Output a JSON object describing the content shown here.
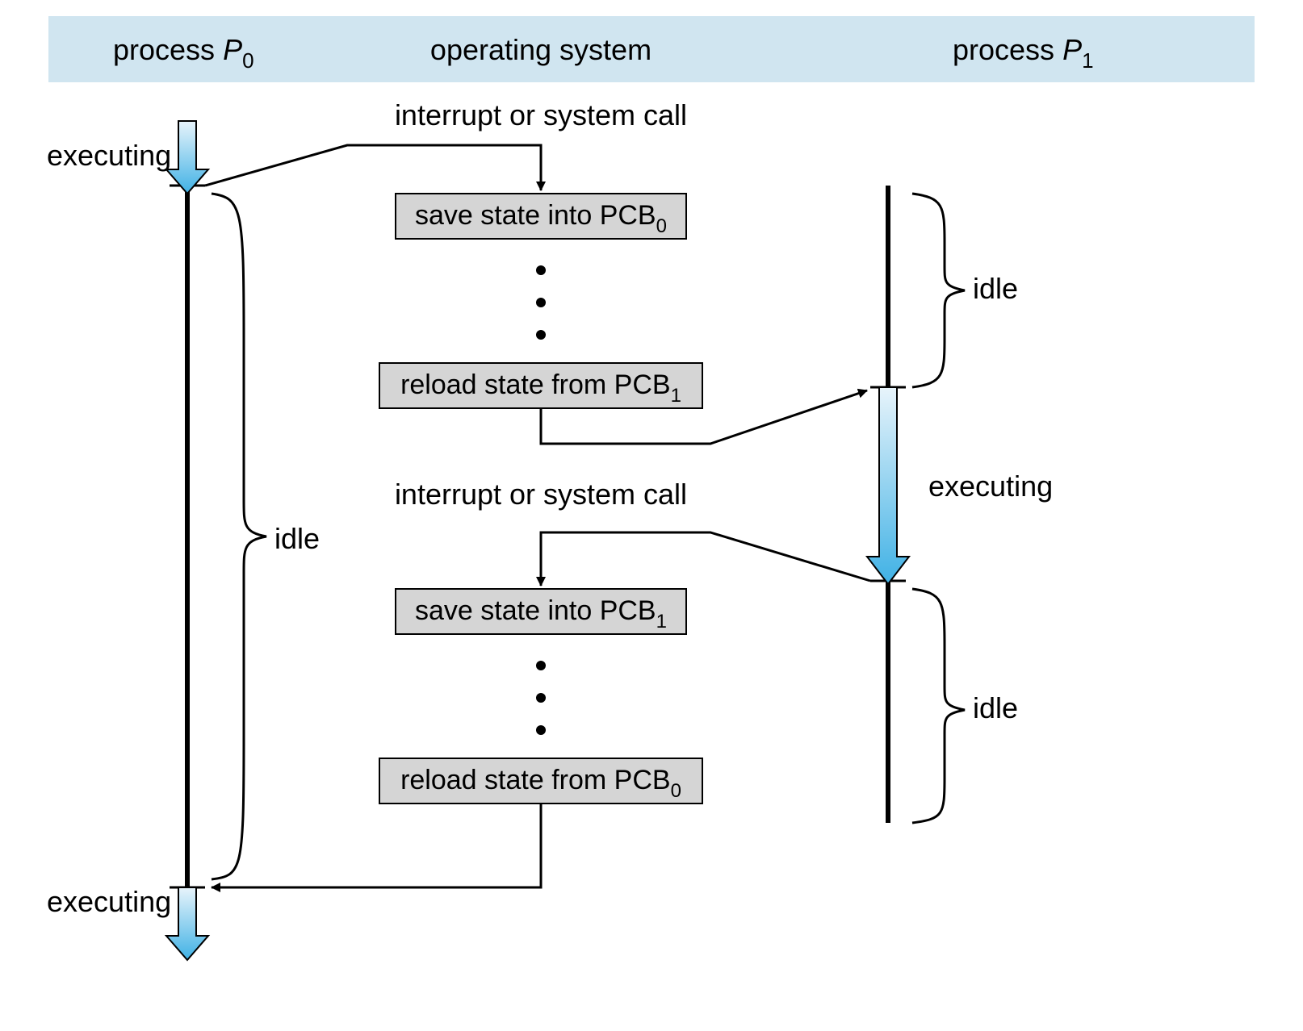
{
  "header": {
    "left": {
      "text": "process ",
      "ital": "P",
      "sub": "0"
    },
    "center": "operating system",
    "right": {
      "text": "process ",
      "ital": "P",
      "sub": "1"
    }
  },
  "labels": {
    "executing_top": "executing",
    "executing_bottom": "executing",
    "executing_right": "executing",
    "idle_left": "idle",
    "idle_right_top": "idle",
    "idle_right_bottom": "idle",
    "interrupt1": "interrupt or system call",
    "interrupt2": "interrupt or system call"
  },
  "boxes": {
    "save0": {
      "text": "save state into PCB",
      "sub": "0"
    },
    "reload1": {
      "text": "reload state from PCB",
      "sub": "1"
    },
    "save1": {
      "text": "save state into PCB",
      "sub": "1"
    },
    "reload0": {
      "text": "reload state from PCB",
      "sub": "0"
    }
  }
}
